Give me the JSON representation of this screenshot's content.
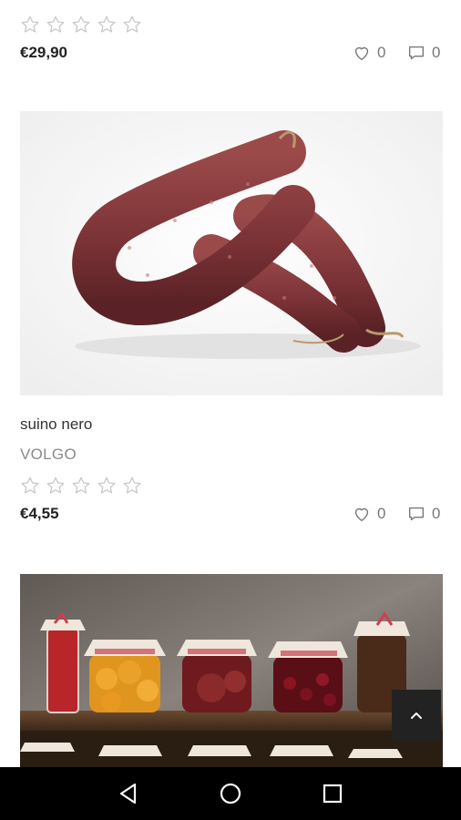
{
  "products": [
    {
      "price": "€29,90",
      "rating": 0,
      "likes": "0",
      "comments": "0"
    },
    {
      "title": "suino nero",
      "brand": "VOLGO",
      "price": "€4,55",
      "rating": 0,
      "likes": "0",
      "comments": "0",
      "image": "salami sausages on white background"
    },
    {
      "image": "preserved fruit jars with checkered lids on wooden shelf"
    }
  ],
  "icons": {
    "star": "star-outline-icon",
    "like": "heart-outline-icon",
    "comment": "speech-bubble-icon",
    "scroll_top": "chevron-up-icon",
    "nav_back": "triangle-back-icon",
    "nav_home": "circle-home-icon",
    "nav_recent": "square-recent-icon"
  },
  "colors": {
    "star": "#c8c8c8",
    "meta": "#777777",
    "navbar": "#000000",
    "scroll_top_bg": "#222222"
  }
}
